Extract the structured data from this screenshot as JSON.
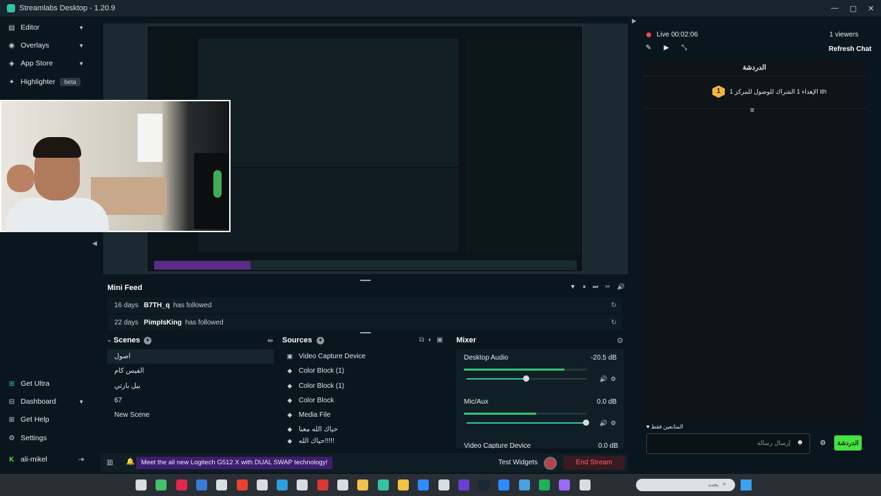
{
  "window": {
    "title": "Streamlabs Desktop - 1.20.9",
    "controls": [
      "—",
      "▢",
      "✕"
    ]
  },
  "sidebar": {
    "items": [
      {
        "label": "Editor",
        "icon": "editor-icon",
        "glyph": "▤",
        "chevron": "▼"
      },
      {
        "label": "Overlays",
        "icon": "overlays-icon",
        "glyph": "◉",
        "chevron": "▼"
      },
      {
        "label": "App Store",
        "icon": "app-store-icon",
        "glyph": "◈",
        "chevron": "▼"
      },
      {
        "label": "Highlighter",
        "icon": "highlighter-icon",
        "glyph": "✦",
        "badge": "beta"
      }
    ],
    "bottom_items": [
      {
        "label": "Get Ultra",
        "icon": "ultra-icon",
        "glyph": "⊞"
      },
      {
        "label": "Dashboard",
        "icon": "dashboard-icon",
        "glyph": "⊟",
        "chevron": "▼"
      },
      {
        "label": "Get Help",
        "icon": "help-icon",
        "glyph": "⊞"
      },
      {
        "label": "Settings",
        "icon": "gear-icon",
        "glyph": "⚙"
      },
      {
        "label": "ali-mikel",
        "icon": "kick-icon",
        "glyph": "K",
        "action": "⇥"
      }
    ]
  },
  "preview": {
    "collapse_left": "◀",
    "collapse_right": "▶",
    "inner_promo": "Meet the all new Logitech G512 X with DUAL SWAP technology!"
  },
  "mini_feed": {
    "title": "Mini Feed",
    "controls": [
      "▼",
      "⏸",
      "⏭",
      "✂",
      "🔊"
    ],
    "rows": [
      {
        "age": "16 days",
        "user": "B7TH_q",
        "action": "has followed",
        "refresh": "↻"
      },
      {
        "age": "22 days",
        "user": "PimpIsKing",
        "action": "has followed",
        "refresh": "↻"
      }
    ]
  },
  "scenes": {
    "title": "Scenes",
    "toggle": "⌄",
    "add": "+",
    "tool": "⇹",
    "items": [
      "اصول",
      "الفيس كام",
      "بيل بارتي",
      "67",
      "New Scene"
    ]
  },
  "sources": {
    "title": "Sources",
    "add": "+",
    "tools": [
      "⧉",
      "◐",
      "▣"
    ],
    "items": [
      {
        "label": "Video Capture Device",
        "glyph": "▣"
      },
      {
        "label": "Color Block (1)",
        "glyph": "◆"
      },
      {
        "label": "Color Block (1)",
        "glyph": "◆"
      },
      {
        "label": "Color Block",
        "glyph": "◆"
      },
      {
        "label": "Media File",
        "glyph": "◆"
      },
      {
        "label": "حياك الله معنا",
        "glyph": "◆"
      },
      {
        "label": "حياك الله!!!!!",
        "glyph": "◆"
      }
    ]
  },
  "mixer": {
    "title": "Mixer",
    "settings": "⚙",
    "channels": [
      {
        "name": "Desktop Audio",
        "db": "-20.5 dB",
        "level": 0.82,
        "volume": 0.5
      },
      {
        "name": "Mic/Aux",
        "db": "0.0 dB",
        "level": 0.59,
        "volume": 1.0
      },
      {
        "name": "Video Capture Device",
        "db": "0.0 dB",
        "level": 0,
        "volume": 1.0
      }
    ],
    "mute_icon": "🔊",
    "gear_icon": "⚙"
  },
  "footer": {
    "stats_icon": "▥",
    "notify_icon": "🔔",
    "promo": "Meet the all new Logitech G512 X with DUAL SWAP technology!",
    "test_widgets": "Test Widgets",
    "end_stream": "End Stream"
  },
  "chat": {
    "live_label": "Live 00:02:06",
    "viewers": "1 viewers",
    "refresh": "Refresh Chat",
    "tools": [
      "✎",
      "▶",
      "⤡"
    ],
    "header": "الدردشة",
    "pinned_badge": "1",
    "pinned_text": "الإهداء 1 الشراك للوصول للمركز 1 ith",
    "menu": "≡",
    "followers_only": "♥ المتابعين فقط",
    "input_placeholder": "إرسال رسالة",
    "emoji": "☻",
    "settings": "⚙",
    "send": "الدردشة"
  },
  "taskbar": {
    "search_placeholder": "بحث",
    "search_icon": "⌕",
    "icon_colors": [
      "#d9dde1",
      "#43c26b",
      "#e0294a",
      "#3a7bd5",
      "#d9dde1",
      "#e94235",
      "#d9dde1",
      "#2aa1de",
      "#d9dde1",
      "#d93636",
      "#d9dde1",
      "#f0c24a",
      "#31c3a2",
      "#f5c342",
      "#2d8cff",
      "#d9dde1",
      "#6a3fd1",
      "#1b2838",
      "#2d8cff",
      "#4aa3df",
      "#1fb15a",
      "#9b6bff",
      "#d9dde1"
    ]
  },
  "colors": {
    "accent": "#31c3a2",
    "live": "#f04a4a",
    "send": "#43e33f",
    "end_stream": "#ff5d6c"
  }
}
